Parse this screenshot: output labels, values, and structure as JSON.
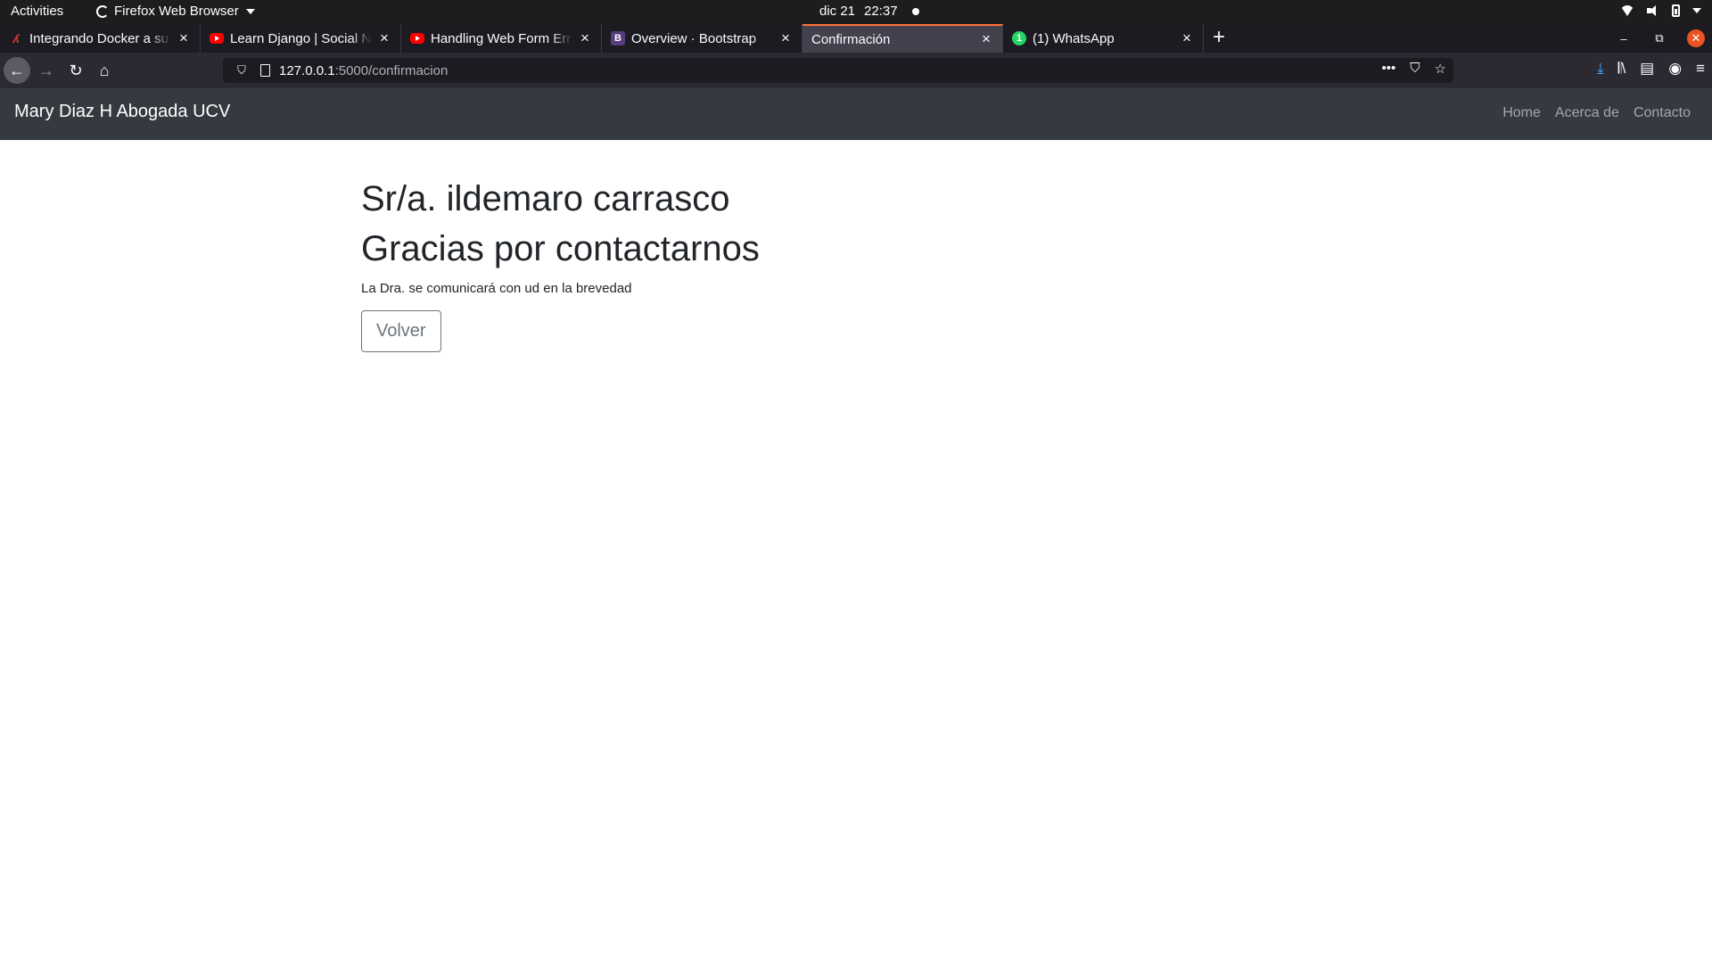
{
  "system_bar": {
    "activities": "Activities",
    "app_name": "Firefox Web Browser",
    "date": "dic 21",
    "time": "22:37"
  },
  "tabs": [
    {
      "title": "Integrando Docker a su la",
      "favicon": "docker-tutorial-icon",
      "active": false
    },
    {
      "title": "Learn Django | Social Net",
      "favicon": "youtube-icon",
      "active": false
    },
    {
      "title": "Handling Web Form Error",
      "favicon": "youtube-icon",
      "active": false
    },
    {
      "title": "Overview · Bootstrap",
      "favicon": "bootstrap-icon",
      "favicon_text": "B",
      "active": false
    },
    {
      "title": "Confirmación",
      "favicon": "",
      "active": true
    },
    {
      "title": "(1) WhatsApp",
      "favicon": "whatsapp-icon",
      "favicon_text": "1",
      "active": false
    }
  ],
  "url_bar": {
    "host": "127.0.0.1",
    "path": ":5000/confirmacion"
  },
  "site": {
    "brand": "Mary Diaz H Abogada UCV",
    "nav_links": [
      "Home",
      "Acerca de",
      "Contacto"
    ],
    "heading_name": "Sr/a. ildemaro carrasco",
    "heading_thanks": "Gracias por contactarnos",
    "message": "La Dra. se comunicará con ud en la brevedad",
    "back_button": "Volver"
  },
  "colors": {
    "navbar_bg": "#343a40",
    "active_tab_accent": "#ff7139",
    "button_outline": "#6c757d"
  }
}
